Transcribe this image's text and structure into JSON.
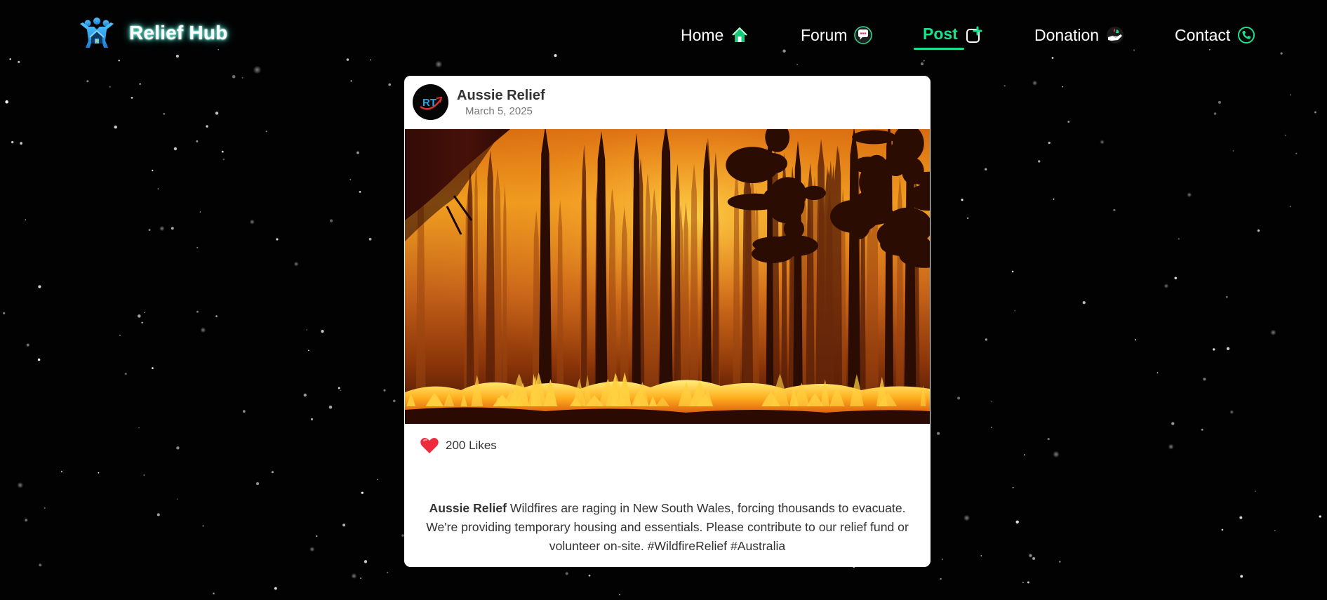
{
  "brand": {
    "name": "Relief Hub",
    "logo_icon": "helping-people-icon",
    "glow_color": "#7fffe9"
  },
  "nav": {
    "items": [
      {
        "label": "Home",
        "icon": "home-icon",
        "active": false
      },
      {
        "label": "Forum",
        "icon": "chat-bubble-icon",
        "active": false
      },
      {
        "label": "Post",
        "icon": "add-post-icon",
        "active": true
      },
      {
        "label": "Donation",
        "icon": "donation-hand-icon",
        "active": false
      },
      {
        "label": "Contact",
        "icon": "phone-icon",
        "active": false
      }
    ],
    "active_color": "#19e38a",
    "text_color": "#ffffff"
  },
  "post": {
    "author": "Aussie Relief",
    "date": "March 5, 2025",
    "avatar_initials": "RT",
    "image_subject": "forest-wildfire-photo",
    "likes_label": "200 Likes",
    "caption_author": "Aussie Relief",
    "caption_text": " Wildfires are raging in New South Wales, forcing thousands to evacuate. We're providing temporary housing and essentials. Please contribute to our relief fund or volunteer on-site. #WildfireRelief #Australia",
    "like_icon": "heart-icon",
    "like_color": "#ee2b3b"
  }
}
